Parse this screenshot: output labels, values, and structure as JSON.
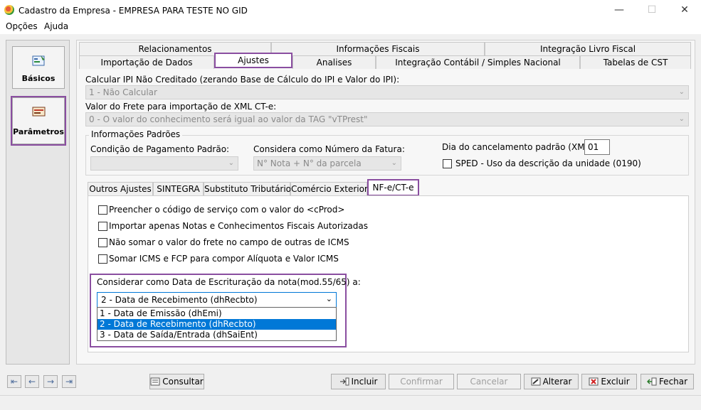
{
  "window": {
    "title": "Cadastro da Empresa - EMPRESA PARA TESTE NO GID",
    "minimize_icon": "minimize-icon",
    "maximize_icon": "maximize-icon",
    "close_icon": "close-icon"
  },
  "menu": {
    "items": [
      "Opções",
      "Ajuda"
    ]
  },
  "sidebar": {
    "items": [
      {
        "label": "Básicos",
        "icon": "basicos-icon"
      },
      {
        "label": "Parâmetros",
        "icon": "parametros-icon"
      }
    ]
  },
  "tabs": {
    "row1": [
      "Relacionamentos",
      "Informações Fiscais",
      "Integração Livro Fiscal"
    ],
    "row2": [
      "Importação de Dados",
      "Ajustes",
      "Analises",
      "Integração Contábil / Simples Nacional",
      "Tabelas de CST"
    ],
    "active": "Ajustes"
  },
  "ajustes": {
    "ipi_label": "Calcular IPI Não Creditado (zerando Base de Cálculo do IPI e Valor do IPI):",
    "ipi_value": "1 - Não Calcular",
    "frete_label": "Valor do Frete para importação de XML CT-e:",
    "frete_value": "0 - O valor do conhecimento será igual ao valor da TAG \"vTPrest\"",
    "info_padroes": {
      "legend": "Informações Padrões",
      "cond_pag_label": "Condição de Pagamento Padrão:",
      "cond_pag_value": "",
      "num_fatura_label": "Considera como Número da Fatura:",
      "num_fatura_value": "N° Nota + N° da parcela",
      "dia_cancel_label": "Dia do cancelamento padrão (XML):",
      "dia_cancel_value": "01",
      "sped_label": "SPED - Uso da descrição da unidade (0190)"
    }
  },
  "subtabs": {
    "items": [
      "Outros Ajustes",
      "SINTEGRA",
      "Substituto Tributário",
      "Comércio Exterior",
      "NF-e/CT-e"
    ],
    "active": "NF-e/CT-e"
  },
  "nfe": {
    "checks": [
      "Preencher o código de serviço com o valor do <cProd>",
      "Importar apenas Notas e Conhecimentos Fiscais Autorizadas",
      "Não somar o valor do frete no campo de outras de ICMS",
      "Somar ICMS e FCP para compor Alíquota e Valor ICMS"
    ],
    "escrituracao_label": "Considerar como Data de Escrituração da nota(mod.55/65) a:",
    "escrituracao_value": "2 -  Data de Recebimento (dhRecbto)",
    "options": [
      "1 -  Data de Emissão (dhEmi)",
      "2 -  Data de Recebimento (dhRecbto)",
      "3 -  Data de Saída/Entrada (dhSaiEnt)"
    ],
    "selected_index": 1
  },
  "nav_buttons": [
    "first-icon",
    "prev-icon",
    "next-icon",
    "last-icon"
  ],
  "buttons": {
    "consultar": "Consultar",
    "incluir": "Incluir",
    "confirmar": "Confirmar",
    "cancelar": "Cancelar",
    "alterar": "Alterar",
    "excluir": "Excluir",
    "fechar": "Fechar"
  },
  "colors": {
    "highlight": "#8a4ea0",
    "selection": "#0078d7"
  }
}
